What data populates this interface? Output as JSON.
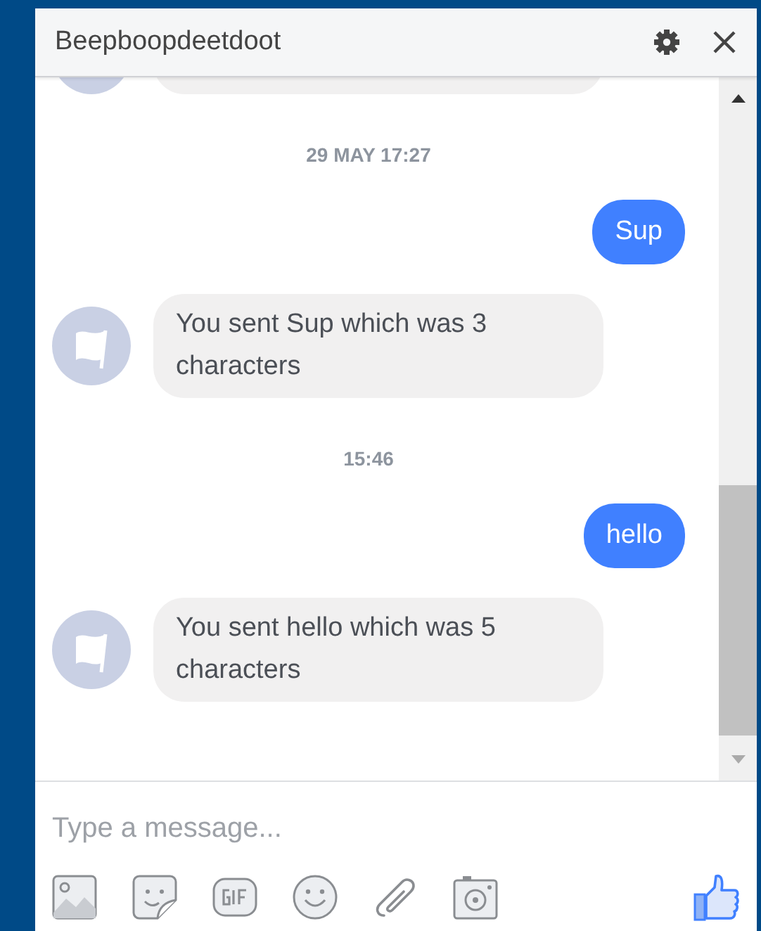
{
  "window": {
    "title": "Beepboopdeetdoot"
  },
  "messages": [
    {
      "kind": "partial"
    },
    {
      "kind": "time",
      "text": "29 MAY 17:27"
    },
    {
      "kind": "sent",
      "text": "Sup"
    },
    {
      "kind": "received",
      "text": "You sent Sup which was 3 characters"
    },
    {
      "kind": "time",
      "text": "15:46"
    },
    {
      "kind": "sent",
      "text": "hello"
    },
    {
      "kind": "received",
      "text": "You sent hello which was 5 characters"
    }
  ],
  "composer": {
    "placeholder": "Type a message..."
  }
}
